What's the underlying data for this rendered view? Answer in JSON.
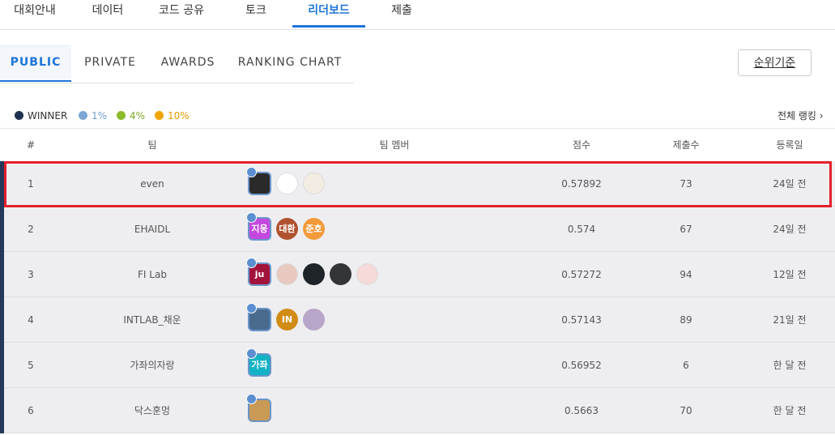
{
  "nav": [
    {
      "label": "대회안내"
    },
    {
      "label": "데이터"
    },
    {
      "label": "코드 공유"
    },
    {
      "label": "토크"
    },
    {
      "label": "리더보드"
    },
    {
      "label": "제출"
    }
  ],
  "subtabs": [
    {
      "label": "PUBLIC"
    },
    {
      "label": "PRIVATE"
    },
    {
      "label": "AWARDS"
    },
    {
      "label": "RANKING CHART"
    }
  ],
  "criteria_button": "순위기준",
  "legend": [
    {
      "label": "WINNER",
      "color": "#1f3350"
    },
    {
      "label": "1%",
      "color": "#7aa7d4"
    },
    {
      "label": "4%",
      "color": "#8dba2a"
    },
    {
      "label": "10%",
      "color": "#f0a500"
    }
  ],
  "all_ranking": "전체 랭킹 ›",
  "columns": {
    "rank": "#",
    "team": "팀",
    "members": "팀 멤버",
    "score": "점수",
    "submissions": "제출수",
    "date": "등록일"
  },
  "rows": [
    {
      "rank": "1",
      "team": "even",
      "score": "0.57892",
      "submissions": "73",
      "date": "24일 전",
      "members": [
        {
          "text": "",
          "color": "#2a2a2a"
        },
        {
          "text": "",
          "color": "#ffffff"
        },
        {
          "text": "",
          "color": "#f3ece2"
        }
      ]
    },
    {
      "rank": "2",
      "team": "EHAIDL",
      "score": "0.574",
      "submissions": "67",
      "date": "24일 전",
      "members": [
        {
          "text": "지웅",
          "color": "#c447e0"
        },
        {
          "text": "대환",
          "color": "#b0522e"
        },
        {
          "text": "준호",
          "color": "#f29a3a"
        }
      ]
    },
    {
      "rank": "3",
      "team": "FI Lab",
      "score": "0.57272",
      "submissions": "94",
      "date": "12일 전",
      "members": [
        {
          "text": "ju",
          "color": "#a3123b"
        },
        {
          "text": "",
          "color": "#e8c9bf"
        },
        {
          "text": "",
          "color": "#1e2428"
        },
        {
          "text": "",
          "color": "#333538"
        },
        {
          "text": "",
          "color": "#f6d9d9"
        }
      ]
    },
    {
      "rank": "4",
      "team": "INTLAB_채운",
      "score": "0.57143",
      "submissions": "89",
      "date": "21일 전",
      "members": [
        {
          "text": "",
          "color": "#4a6a8e"
        },
        {
          "text": "IN",
          "color": "#d18c16"
        },
        {
          "text": "",
          "color": "#b7a6c9"
        }
      ]
    },
    {
      "rank": "5",
      "team": "가좌의자랑",
      "score": "0.56952",
      "submissions": "6",
      "date": "한 달 전",
      "members": [
        {
          "text": "가좌",
          "color": "#12b3c4"
        }
      ]
    },
    {
      "rank": "6",
      "team": "닥스훈멍",
      "score": "0.5663",
      "submissions": "70",
      "date": "한 달 전",
      "members": [
        {
          "text": "",
          "color": "#c89a55"
        }
      ]
    }
  ]
}
